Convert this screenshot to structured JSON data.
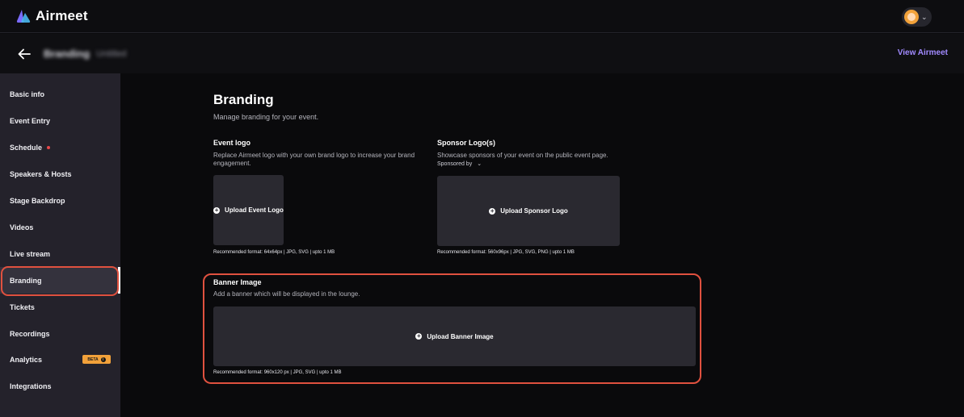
{
  "app": {
    "name": "Airmeet",
    "brand_color": "#6b5cff"
  },
  "header": {
    "user_avatar": "avatar",
    "user_menu_icon": "chevron-down-icon"
  },
  "subheader": {
    "back_icon": "arrow-left-icon",
    "breadcrumb_main": "Branding",
    "breadcrumb_sub": "Untitled",
    "view_link": "View Airmeet"
  },
  "sidebar": {
    "items": [
      {
        "label": "Basic info"
      },
      {
        "label": "Event Entry"
      },
      {
        "label": "Schedule",
        "badge": "red-dot"
      },
      {
        "label": "Speakers & Hosts"
      },
      {
        "label": "Stage Backdrop"
      },
      {
        "label": "Videos"
      },
      {
        "label": "Live stream"
      },
      {
        "label": "Branding",
        "active": true
      },
      {
        "label": "Tickets"
      },
      {
        "label": "Recordings"
      },
      {
        "label": "Analytics",
        "badge": "BETA"
      },
      {
        "label": "Integrations"
      }
    ],
    "beta_label": "BETA",
    "beta_info": "i"
  },
  "main": {
    "title": "Branding",
    "subtitle": "Manage branding for your event.",
    "event_logo": {
      "title": "Event logo",
      "description": "Replace Airmeet logo with your own brand logo to increase your brand engagement.",
      "upload_label": "Upload Event Logo",
      "recommendation": "Recommended format: 64x64px | JPG, SVG | upto 1 MB"
    },
    "sponsor_logo": {
      "title": "Sponsor Logo(s)",
      "description": "Showcase sponsors of your event on the public event page.",
      "sponsored_by": "Sponsored by",
      "upload_label": "Upload Sponsor Logo",
      "recommendation": "Recommended format: 560x96px | JPG, SVG, PNG | upto 1 MB"
    },
    "banner": {
      "title": "Banner Image",
      "description": "Add a banner which will be displayed in the lounge.",
      "upload_label": "Upload Banner Image",
      "recommendation": "Recommended format: 960x120 px | JPG, SVG | upto 1 MB"
    }
  },
  "colors": {
    "highlight": "#e0513f",
    "link": "#a18aff",
    "beta_badge": "#f2a13a",
    "dot": "#e8484a"
  }
}
